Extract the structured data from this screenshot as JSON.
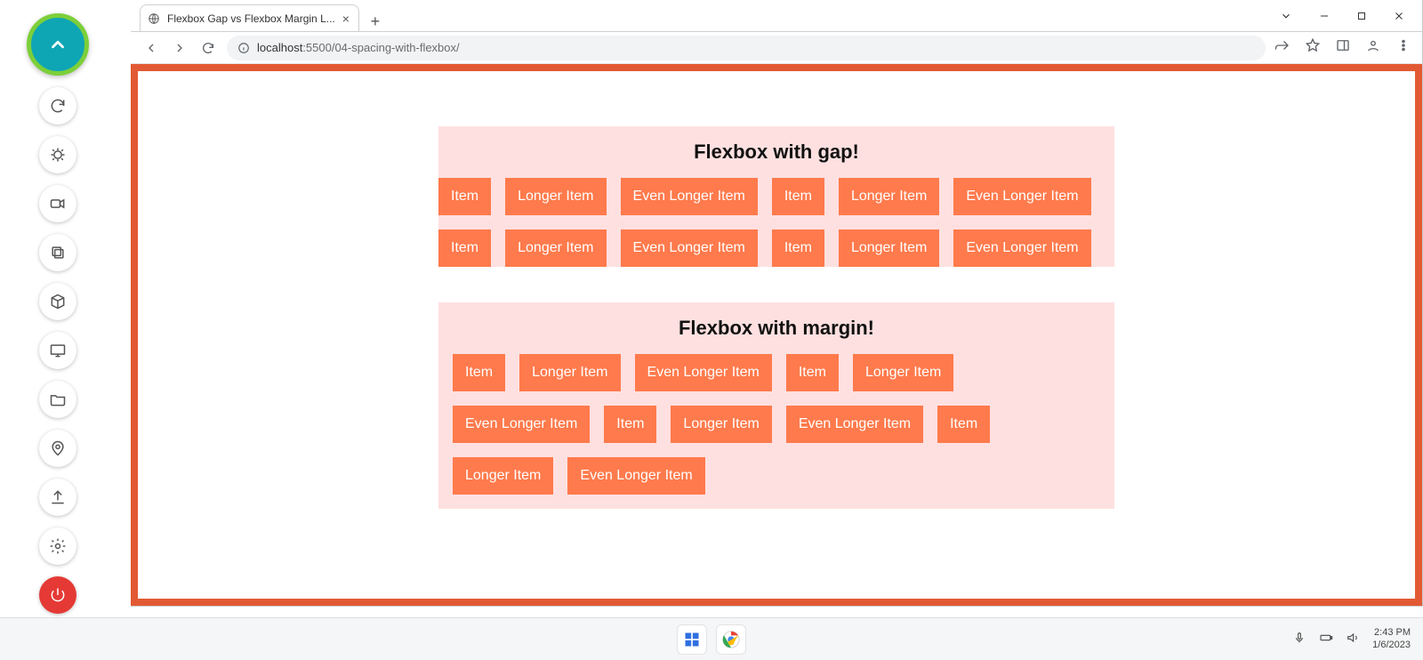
{
  "browser": {
    "tab_title": "Flexbox Gap vs Flexbox Margin L...",
    "url_host": "localhost",
    "url_port_path": ":5500/04-spacing-with-flexbox/"
  },
  "page": {
    "section_gap": {
      "heading": "Flexbox with gap!",
      "items": [
        "Item",
        "Longer Item",
        "Even Longer Item",
        "Item",
        "Longer Item",
        "Even Longer Item",
        "Item",
        "Longer Item",
        "Even Longer Item",
        "Item",
        "Longer Item",
        "Even Longer Item"
      ]
    },
    "section_margin": {
      "heading": "Flexbox with margin!",
      "items": [
        "Item",
        "Longer Item",
        "Even Longer Item",
        "Item",
        "Longer Item",
        "Even Longer Item",
        "Item",
        "Longer Item",
        "Even Longer Item",
        "Item",
        "Longer Item",
        "Even Longer Item"
      ]
    }
  },
  "taskbar": {
    "time": "2:43 PM",
    "date": "1/6/2023"
  },
  "side_icons": [
    "collapse",
    "sync",
    "debug",
    "record",
    "copy",
    "box",
    "display",
    "folder",
    "location",
    "upload",
    "settings",
    "power"
  ]
}
